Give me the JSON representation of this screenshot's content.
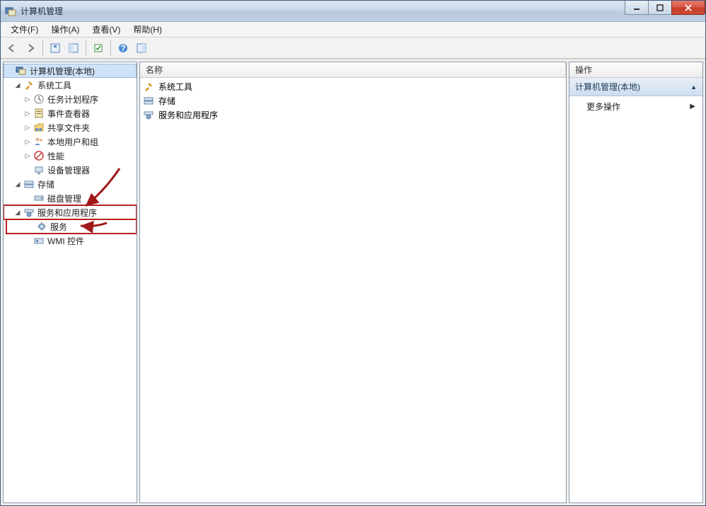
{
  "window": {
    "title": "计算机管理"
  },
  "menu": {
    "file": "文件(F)",
    "action": "操作(A)",
    "view": "查看(V)",
    "help": "帮助(H)"
  },
  "tree": {
    "root": "计算机管理(本地)",
    "system_tools": "系统工具",
    "task_scheduler": "任务计划程序",
    "event_viewer": "事件查看器",
    "shared_folders": "共享文件夹",
    "local_users": "本地用户和组",
    "performance": "性能",
    "device_manager": "设备管理器",
    "storage": "存储",
    "disk_management": "磁盘管理",
    "services_apps": "服务和应用程序",
    "services": "服务",
    "wmi_control": "WMI 控件"
  },
  "list": {
    "col_name": "名称",
    "rows": [
      "系统工具",
      "存储",
      "服务和应用程序"
    ]
  },
  "actions": {
    "header": "操作",
    "group_title": "计算机管理(本地)",
    "more_actions": "更多操作"
  }
}
